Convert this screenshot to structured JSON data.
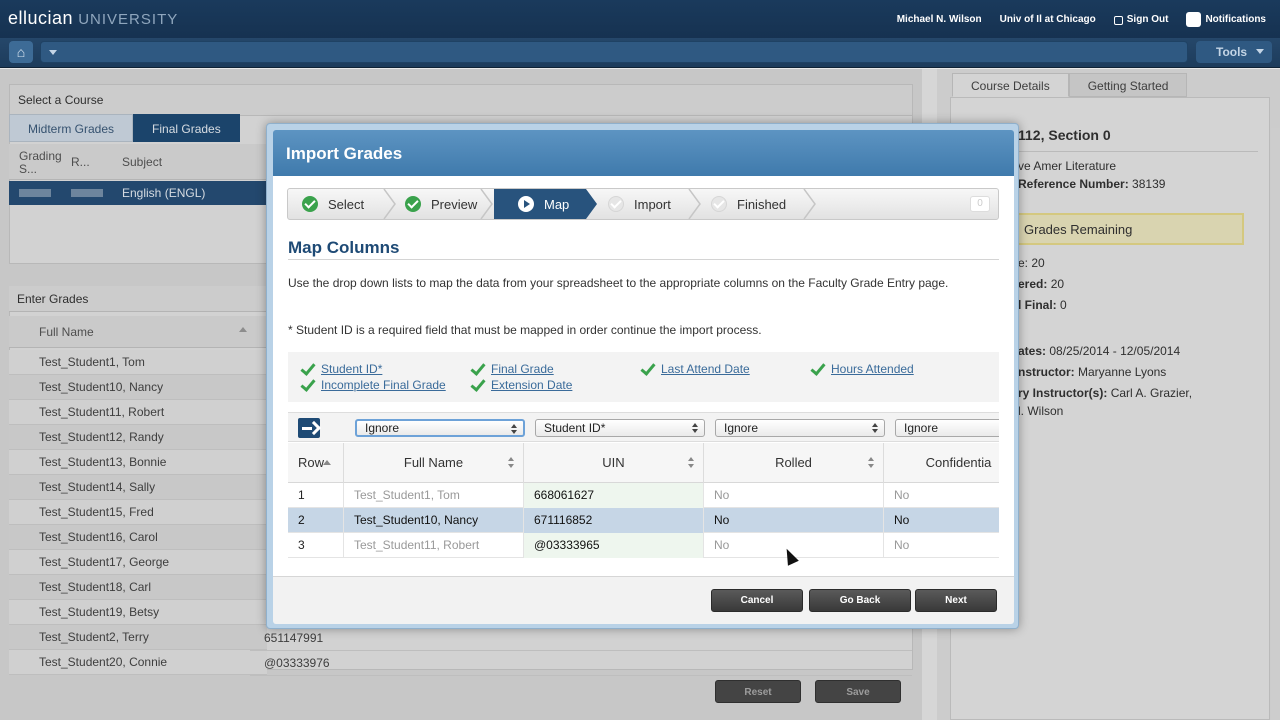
{
  "app": {
    "brand": "ellucian",
    "brand_suffix": "UNIVERSITY",
    "user": "Michael N. Wilson",
    "institution": "Univ of Il at Chicago",
    "sign_out": "Sign Out",
    "notifications": "Notifications",
    "tools": "Tools",
    "home_glyph": "⌂"
  },
  "left": {
    "select_course": "Select a Course",
    "tabs": [
      "Midterm Grades",
      "Final Grades"
    ],
    "head_cols": [
      "Grading S...",
      "R...",
      "Subject"
    ],
    "course_subject": "English (ENGL)",
    "enter_grades": "Enter Grades",
    "full_name_header": "Full Name",
    "students": [
      "Test_Student1, Tom",
      "Test_Student10, Nancy",
      "Test_Student11, Robert",
      "Test_Student12, Randy",
      "Test_Student13, Bonnie",
      "Test_Student14, Sally",
      "Test_Student15, Fred",
      "Test_Student16, Carol",
      "Test_Student17, George",
      "Test_Student18, Carl",
      "Test_Student19, Betsy",
      "Test_Student2, Terry",
      "Test_Student20, Connie"
    ],
    "bg_uins": [
      "651147991",
      "@03333976"
    ],
    "reset": "Reset",
    "save": "Save"
  },
  "right": {
    "tabs": [
      "Course Details",
      "Getting Started"
    ],
    "title": "112, Section 0",
    "course_name": "ve Amer Literature",
    "ref_label": "Reference Number:",
    "ref_value": "38139",
    "grades_remaining": "Grades Remaining",
    "stat1": "e: 20",
    "stat2_label": "ered:",
    "stat2_value": "20",
    "stat3_label": "l Final:",
    "stat3_value": "0",
    "dates_label": "ates:",
    "dates_value": "08/25/2014 - 12/05/2014",
    "instructor_label": "nstructor:",
    "instructor_value": "Maryanne Lyons",
    "secondary_label": "ry Instructor(s):",
    "secondary_value": "Carl A. Grazier,",
    "secondary_value2": "l. Wilson"
  },
  "modal": {
    "title": "Import Grades",
    "steps": [
      "Select",
      "Preview",
      "Map",
      "Import",
      "Finished"
    ],
    "step_count": "0",
    "section_title": "Map Columns",
    "instructions": "Use the drop down lists to map the data from your spreadsheet to the appropriate columns on the Faculty Grade Entry page.",
    "note": "* Student ID is a required field that must be mapped in order continue the import process.",
    "mapped_fields": [
      "Student ID*",
      "Final Grade",
      "Last Attend Date",
      "Hours Attended",
      "Incomplete Final Grade",
      "Extension Date"
    ],
    "selects": [
      "Ignore",
      "Student ID*",
      "Ignore",
      "Ignore"
    ],
    "columns": [
      "Row",
      "Full Name",
      "UIN",
      "Rolled",
      "Confidentia"
    ],
    "rows": [
      {
        "row": "1",
        "name": "Test_Student1, Tom",
        "uin": "668061627",
        "rolled": "No",
        "conf": "No"
      },
      {
        "row": "2",
        "name": "Test_Student10, Nancy",
        "uin": "671116852",
        "rolled": "No",
        "conf": "No"
      },
      {
        "row": "3",
        "name": "Test_Student11, Robert",
        "uin": "@03333965",
        "rolled": "No",
        "conf": "No"
      }
    ],
    "cancel": "Cancel",
    "go_back": "Go Back",
    "next": "Next"
  },
  "colors": {
    "header_bg": "#1a3a5c",
    "modal_header": "#4a86b8",
    "active_step": "#28537d",
    "check_green": "#3aa24c",
    "link_blue": "#3a6b9a"
  }
}
